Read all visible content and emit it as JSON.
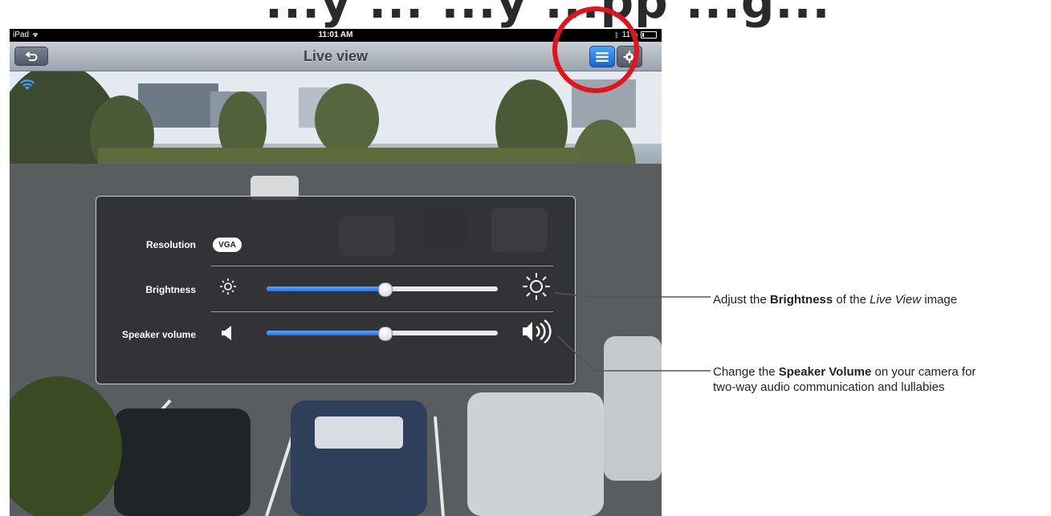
{
  "heading": "...y ... ...y ...pp ...g...",
  "status_bar": {
    "device": "iPad",
    "time": "11:01 AM",
    "battery": "11%"
  },
  "nav": {
    "title": "Live view",
    "back_icon": "back-arrow-icon",
    "menu_icon": "list-menu-icon",
    "settings_icon": "gear-icon"
  },
  "panel": {
    "resolution_label": "Resolution",
    "resolution_value": "VGA",
    "brightness_label": "Brightness",
    "brightness_level": 0.51,
    "speaker_label": "Speaker volume",
    "speaker_level": 0.51
  },
  "captions": {
    "brightness": {
      "prefix": "Adjust the ",
      "bold": "Brightness",
      "middle": " of the ",
      "italic": "Live View",
      "suffix": " image"
    },
    "volume": {
      "prefix": "Change the ",
      "bold": "Speaker Volume",
      "line1_suffix": " on your camera for",
      "line2": "two-way audio communication and lullabies"
    }
  },
  "colors": {
    "highlight": "#e4121a",
    "accent_blue": "#2a6fe0"
  }
}
